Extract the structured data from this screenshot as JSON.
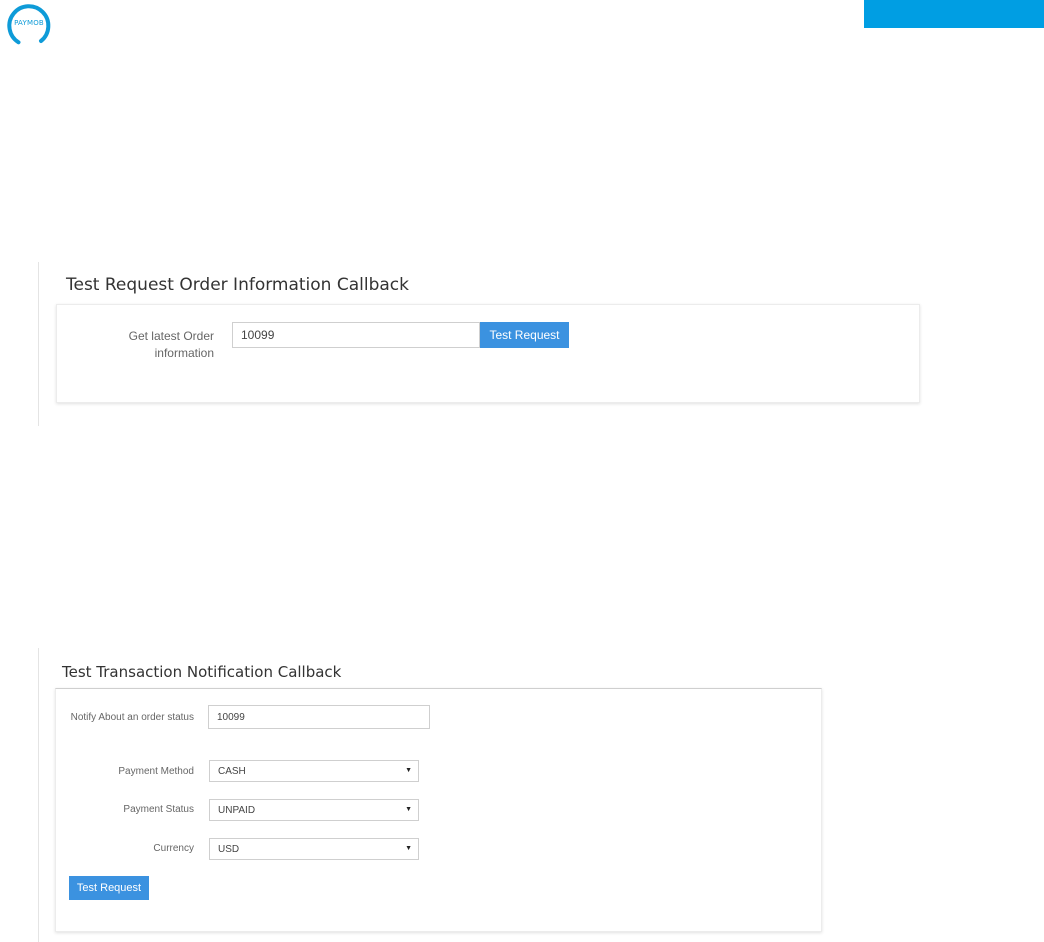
{
  "brand": {
    "logo_text": "PAYMOB"
  },
  "order_info": {
    "title": "Test Request Order Information Callback",
    "label": "Get latest Order information",
    "order_id": "10099",
    "button_label": "Test Request"
  },
  "transaction": {
    "title": "Test Transaction Notification Callback",
    "order_label": "Notify About an order status",
    "order_id": "10099",
    "payment_method_label": "Payment Method",
    "payment_method_value": "CASH",
    "payment_status_label": "Payment Status",
    "payment_status_value": "UNPAID",
    "currency_label": "Currency",
    "currency_value": "USD",
    "button_label": "Test Request"
  },
  "colors": {
    "brand": "#0e9bd8",
    "top_bar": "#009ee3",
    "button": "#3b92e0"
  },
  "icons": {
    "logo": "paymob-logo-icon",
    "select_caret": "caret-down-icon"
  }
}
